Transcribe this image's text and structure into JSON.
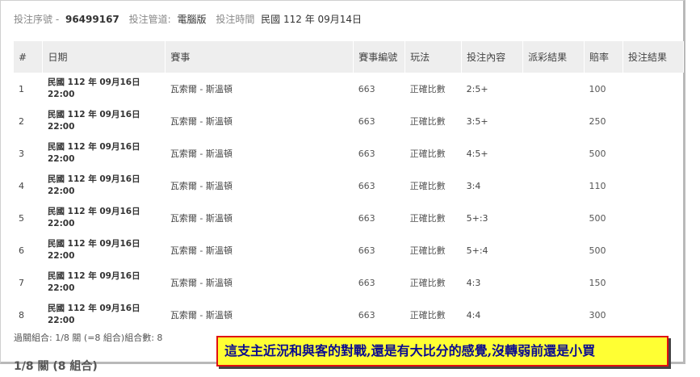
{
  "header": {
    "serial_label": "投注序號 -",
    "serial_value": "96499167",
    "channel_label": "投注管道:",
    "channel_value": "電腦版",
    "time_label": "投注時間",
    "time_value": "民國 112 年 09月14日"
  },
  "table": {
    "columns": [
      "#",
      "日期",
      "賽事",
      "賽事編號",
      "玩法",
      "投注內容",
      "派彩結果",
      "賠率",
      "投注結果"
    ],
    "rows": [
      {
        "idx": "1",
        "date": "民國 112 年 09月16日",
        "time": "22:00",
        "match": "瓦索爾 - 斯溫頓",
        "code": "663",
        "play": "正確比數",
        "content": "2:5+",
        "payout": "",
        "odds": "100",
        "result": ""
      },
      {
        "idx": "2",
        "date": "民國 112 年 09月16日",
        "time": "22:00",
        "match": "瓦索爾 - 斯溫頓",
        "code": "663",
        "play": "正確比數",
        "content": "3:5+",
        "payout": "",
        "odds": "250",
        "result": ""
      },
      {
        "idx": "3",
        "date": "民國 112 年 09月16日",
        "time": "22:00",
        "match": "瓦索爾 - 斯溫頓",
        "code": "663",
        "play": "正確比數",
        "content": "4:5+",
        "payout": "",
        "odds": "500",
        "result": ""
      },
      {
        "idx": "4",
        "date": "民國 112 年 09月16日",
        "time": "22:00",
        "match": "瓦索爾 - 斯溫頓",
        "code": "663",
        "play": "正確比數",
        "content": "3:4",
        "payout": "",
        "odds": "110",
        "result": ""
      },
      {
        "idx": "5",
        "date": "民國 112 年 09月16日",
        "time": "22:00",
        "match": "瓦索爾 - 斯溫頓",
        "code": "663",
        "play": "正確比數",
        "content": "5+:3",
        "payout": "",
        "odds": "500",
        "result": ""
      },
      {
        "idx": "6",
        "date": "民國 112 年 09月16日",
        "time": "22:00",
        "match": "瓦索爾 - 斯溫頓",
        "code": "663",
        "play": "正確比數",
        "content": "5+:4",
        "payout": "",
        "odds": "500",
        "result": ""
      },
      {
        "idx": "7",
        "date": "民國 112 年 09月16日",
        "time": "22:00",
        "match": "瓦索爾 - 斯溫頓",
        "code": "663",
        "play": "正確比數",
        "content": "4:3",
        "payout": "",
        "odds": "150",
        "result": ""
      },
      {
        "idx": "8",
        "date": "民國 112 年 09月16日",
        "time": "22:00",
        "match": "瓦索爾 - 斯溫頓",
        "code": "663",
        "play": "正確比數",
        "content": "4:4",
        "payout": "",
        "odds": "300",
        "result": ""
      }
    ]
  },
  "summary": {
    "combo_line": "過關組合: 1/8 關 (=8 組合)組合數: 8",
    "section_title": "1/8 關 (8 組合)"
  },
  "overlay": {
    "text": "這支主近況和與客的對戰,還是有大比分的感覺,沒轉弱前還是小買"
  }
}
